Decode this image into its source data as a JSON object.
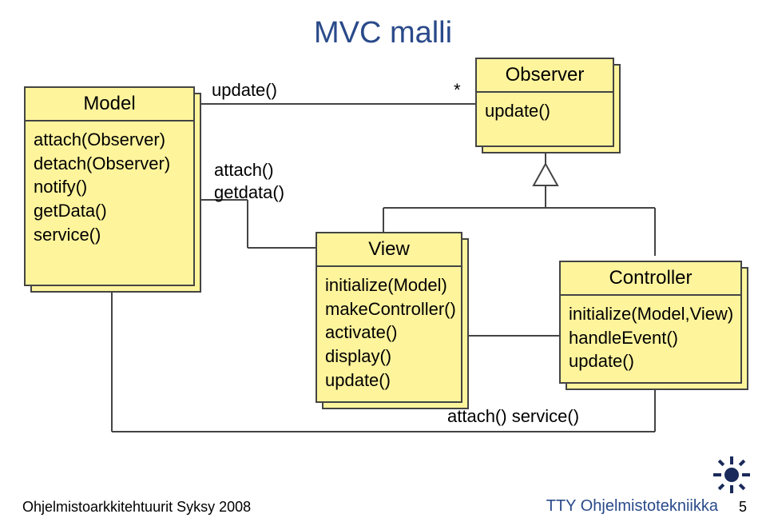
{
  "title": "MVC malli",
  "classes": {
    "model": {
      "name": "Model",
      "ops": [
        "attach(Observer)",
        "detach(Observer)",
        "notify()",
        "getData()",
        "service()"
      ]
    },
    "observer": {
      "name": "Observer",
      "ops": [
        "update()"
      ]
    },
    "view": {
      "name": "View",
      "ops": [
        "initialize(Model)",
        "makeController()",
        "activate()",
        "display()",
        "update()"
      ]
    },
    "controller": {
      "name": "Controller",
      "ops": [
        "initialize(Model,View)",
        "handleEvent()",
        "update()"
      ]
    }
  },
  "labels": {
    "assoc_update": "update()",
    "assoc_mult": "*",
    "attach_getdata_line1": "attach()",
    "attach_getdata_line2": "getdata()",
    "attach_service": "attach()  service()"
  },
  "footer": {
    "left": "Ohjelmistoarkkitehtuurit Syksy 2008",
    "right": "TTY Ohjelmistotekniikka",
    "page": "5"
  },
  "colors": {
    "box_fill": "#FEF49C",
    "box_border": "#444444",
    "title_color": "#2a4a8a"
  }
}
